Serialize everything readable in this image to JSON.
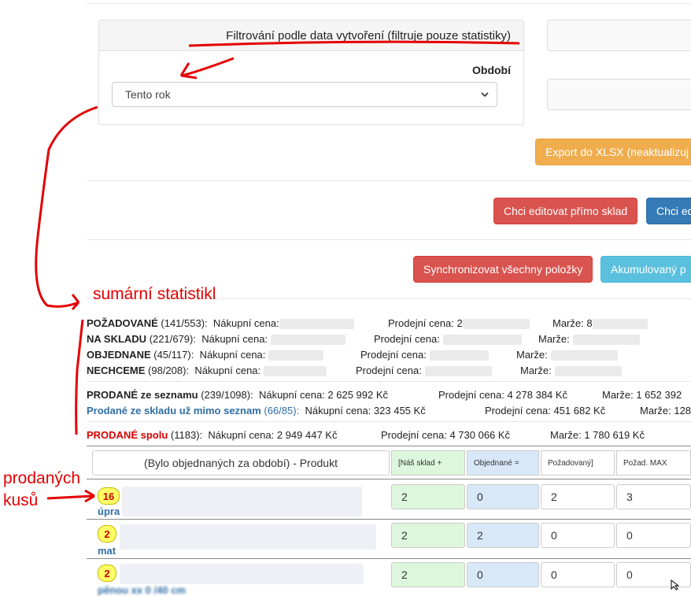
{
  "filter": {
    "title": "Filtrování podle data vytvoření (filtruje pouze statistiky)",
    "period_label": "Období",
    "period_value": "Tento rok"
  },
  "buttons": {
    "export": "Export do XLSX (neaktualizuj",
    "edit_stock": "Chci editovat přímo sklad",
    "edit_other": "Chci ed",
    "sync_all": "Synchronizovat všechny položky",
    "accumulated": "Akumulovaný p"
  },
  "annotations": {
    "summary": "sumární statistikl",
    "sold_pieces_1": "prodaných",
    "sold_pieces_2": "kusů"
  },
  "stats": [
    {
      "name": "POŽADOVANÉ",
      "count": "(141/553):",
      "buy": "Nákupní cena:",
      "sell": "Prodejní cena: 2",
      "margin": "Marže: 8"
    },
    {
      "name": "NA SKLADU",
      "count": "(221/679):",
      "buy": "Nákupní cena:",
      "sell": "Prodejní cena:",
      "margin": "Marže:"
    },
    {
      "name": "OBJEDNANE",
      "count": "(45/117):",
      "buy": "Nákupní cena:",
      "sell": "Prodejní cena:",
      "margin": "Marže:"
    },
    {
      "name": "NECHCEME",
      "count": "(98/208):",
      "buy": "Nákupní cena:",
      "sell": "Prodejní cena:",
      "margin": "Marže:"
    }
  ],
  "sold_list": {
    "name": "PRODANÉ ze seznamu",
    "count": "(239/1098):",
    "buy": "Nákupní cena: 2 625 992 Kč",
    "sell": "Prodejní cena: 4 278 384 Kč",
    "margin": "Marže: 1 652 392"
  },
  "sold_outside": {
    "name": "Prodané ze skladu už mimo seznam",
    "count": "(66/85):",
    "buy": "Nákupní cena: 323 455 Kč",
    "sell": "Prodejní cena: 451 682 Kč",
    "margin": "Marže: 128"
  },
  "sold_total": {
    "name": "PRODANÉ spolu",
    "count": "(1183):",
    "buy": "Nákupní cena: 2 949 447 Kč",
    "sell": "Prodejní cena: 4 730 066 Kč",
    "margin": "Marže: 1 780 619 Kč"
  },
  "table": {
    "headers": [
      "(Bylo objednaných za období)  -  Produkt",
      "[Náš sklad +",
      "Objednané =",
      "Požadovaný]",
      "Požad. MAX"
    ],
    "rows": [
      {
        "badge": "16",
        "label": "úpra",
        "values": [
          "2",
          "0",
          "2",
          "3"
        ]
      },
      {
        "badge": "2",
        "label": "mat",
        "values": [
          "2",
          "2",
          "0",
          "0"
        ]
      },
      {
        "badge": "2",
        "label": "pěnou xx 0 /40 cm",
        "values": [
          "2",
          "0",
          "0",
          "0"
        ]
      }
    ]
  }
}
